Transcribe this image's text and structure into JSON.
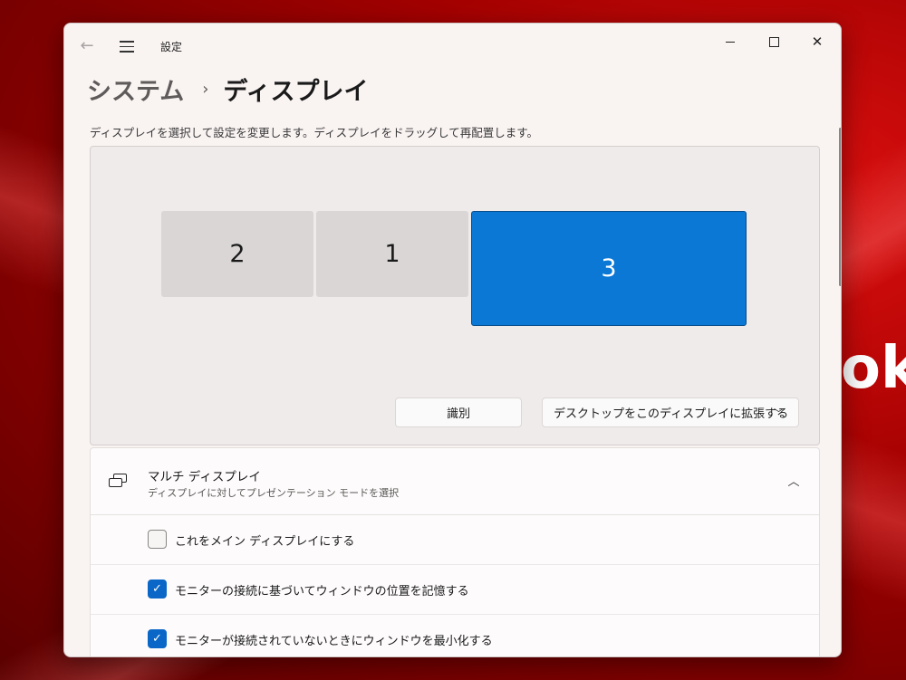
{
  "desktop": {
    "wallpaper_text": "ok"
  },
  "window": {
    "app_title": "設定",
    "back_icon": "arrow-left-icon",
    "controls": {
      "minimize": "",
      "maximize": "",
      "close": "✕"
    }
  },
  "breadcrumb": {
    "parent": "システム",
    "separator": "›",
    "current": "ディスプレイ"
  },
  "arrangement": {
    "instruction": "ディスプレイを選択して設定を変更します。ディスプレイをドラッグして再配置します。",
    "monitors": [
      {
        "label": "2",
        "selected": false
      },
      {
        "label": "1",
        "selected": false
      },
      {
        "label": "3",
        "selected": true
      }
    ],
    "identify_label": "識別",
    "extend_value": "デスクトップをこのディスプレイに拡張する",
    "selected_color": "#0a78d4"
  },
  "multi_display": {
    "title": "マルチ ディスプレイ",
    "subtitle": "ディスプレイに対してプレゼンテーション モードを選択",
    "expanded": true,
    "options": [
      {
        "label": "これをメイン ディスプレイにする",
        "checked": false
      },
      {
        "label": "モニターの接続に基づいてウィンドウの位置を記憶する",
        "checked": true
      },
      {
        "label": "モニターが接続されていないときにウィンドウを最小化する",
        "checked": true
      }
    ]
  }
}
